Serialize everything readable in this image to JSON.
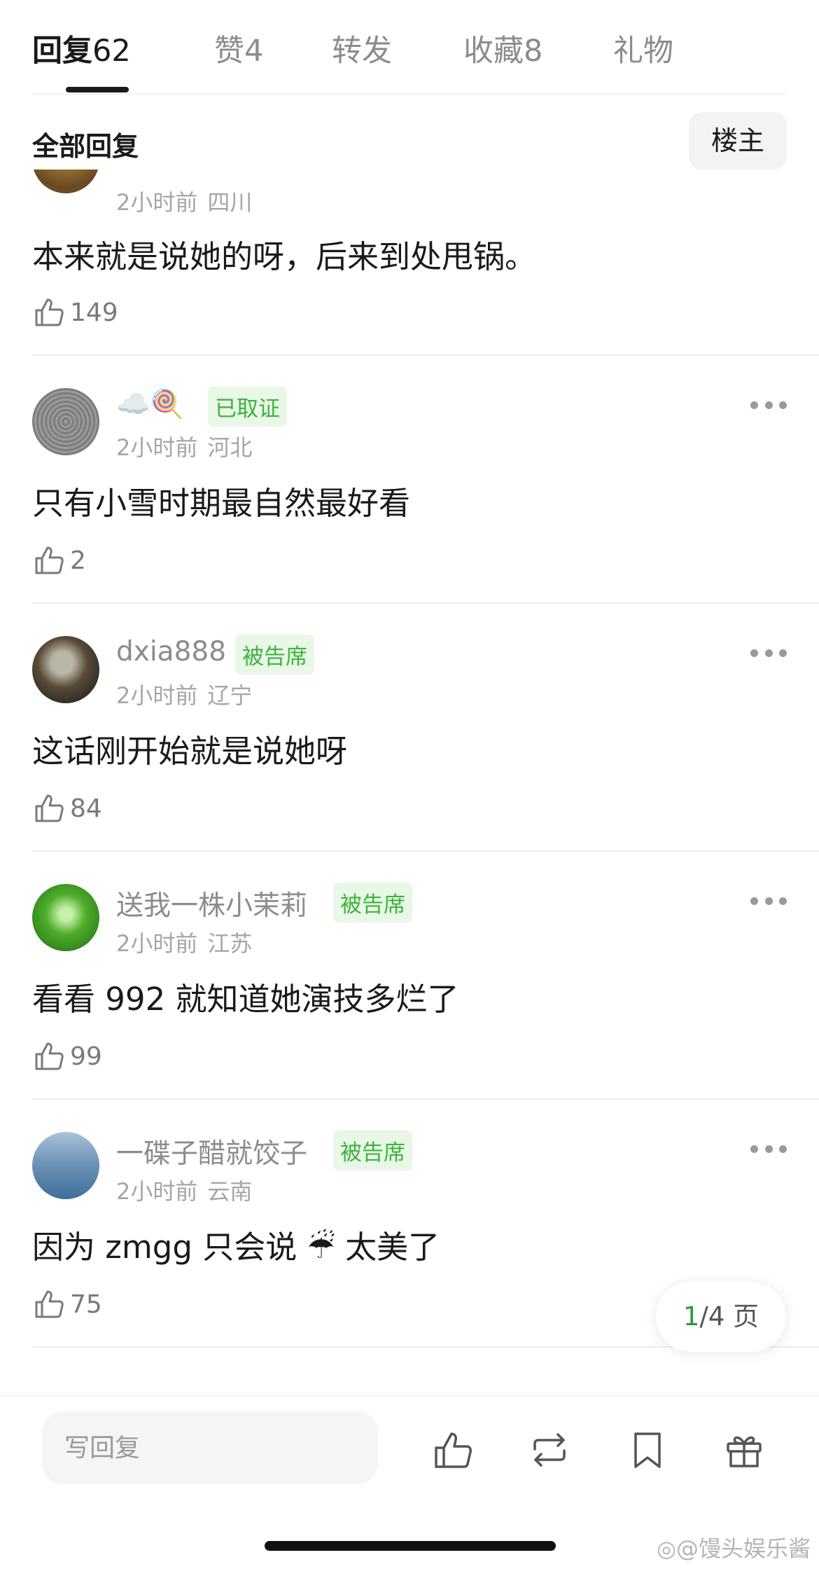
{
  "tabs": [
    {
      "label": "回复",
      "count": "62",
      "active": true
    },
    {
      "label": "赞",
      "count": "4",
      "active": false
    },
    {
      "label": "转发",
      "count": "",
      "active": false
    },
    {
      "label": "收藏",
      "count": "8",
      "active": false
    },
    {
      "label": "礼物",
      "count": "",
      "active": false
    }
  ],
  "subheader": {
    "title": "全部回复",
    "owner_button": "楼主"
  },
  "comments": [
    {
      "username": "",
      "badge": "",
      "time": "2小时前",
      "location": "四川",
      "text": "本来就是说她的呀，后来到处甩锅。",
      "likes": "149"
    },
    {
      "username": "☁️🍭",
      "badge": "已取证",
      "time": "2小时前",
      "location": "河北",
      "text": "只有小雪时期最自然最好看",
      "likes": "2"
    },
    {
      "username": "dxia888",
      "badge": "被告席",
      "time": "2小时前",
      "location": "辽宁",
      "text": "这话刚开始就是说她呀",
      "likes": "84"
    },
    {
      "username": "送我一株小茉莉",
      "badge": "被告席",
      "time": "2小时前",
      "location": "江苏",
      "text": "看看 992 就知道她演技多烂了",
      "likes": "99"
    },
    {
      "username": "一碟子醋就饺子",
      "badge": "被告席",
      "time": "2小时前",
      "location": "云南",
      "text": "因为 zmgg 只会说 ☔ 太美了",
      "likes": "75"
    }
  ],
  "pager": {
    "current": "1",
    "total_text": "/4 页"
  },
  "bottom": {
    "reply_placeholder": "写回复"
  },
  "watermark": "@馒头娱乐酱",
  "colors": {
    "accent_green": "#3cb43c",
    "badge_bg": "#e9f7e6",
    "text_gray": "#8c8c8c"
  },
  "icons": [
    "thumbs-up-icon",
    "more-icon",
    "like-icon",
    "repost-icon",
    "bookmark-icon",
    "gift-icon",
    "weibo-icon"
  ]
}
